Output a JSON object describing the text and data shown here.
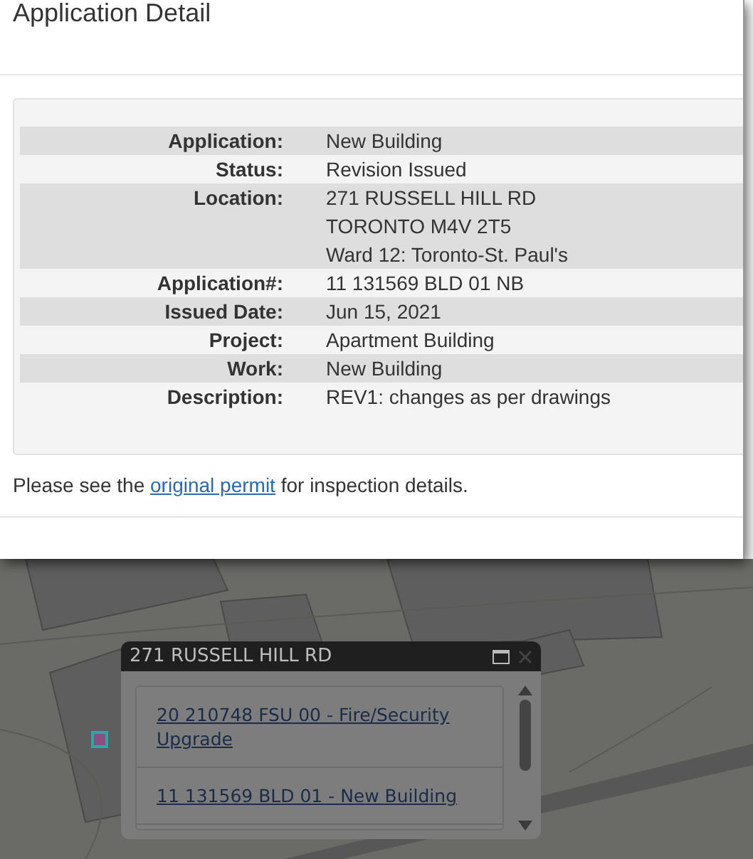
{
  "dialog": {
    "title": "Application Detail",
    "details": [
      {
        "label": "Application:",
        "lines": [
          "New Building"
        ]
      },
      {
        "label": "Status:",
        "lines": [
          "Revision Issued"
        ]
      },
      {
        "label": "Location:",
        "lines": [
          "271 RUSSELL HILL RD",
          "TORONTO M4V 2T5",
          "Ward 12: Toronto-St. Paul's"
        ]
      },
      {
        "label": "Application#:",
        "lines": [
          "11 131569 BLD 01 NB"
        ]
      },
      {
        "label": "Issued Date:",
        "lines": [
          "Jun 15, 2021"
        ]
      },
      {
        "label": "Project:",
        "lines": [
          "Apartment Building"
        ]
      },
      {
        "label": "Work:",
        "lines": [
          "New Building"
        ]
      },
      {
        "label": "Description:",
        "lines": [
          "REV1: changes as per drawings"
        ]
      }
    ],
    "note": {
      "before": "Please see the ",
      "link": "original permit",
      "after": " for inspection details."
    }
  },
  "map_popup": {
    "title": "271 RUSSELL HILL RD",
    "items": [
      {
        "text": "20 210748 FSU 00 - Fire/Security Upgrade"
      },
      {
        "text": "11 131569 BLD 01 - New Building"
      }
    ]
  }
}
